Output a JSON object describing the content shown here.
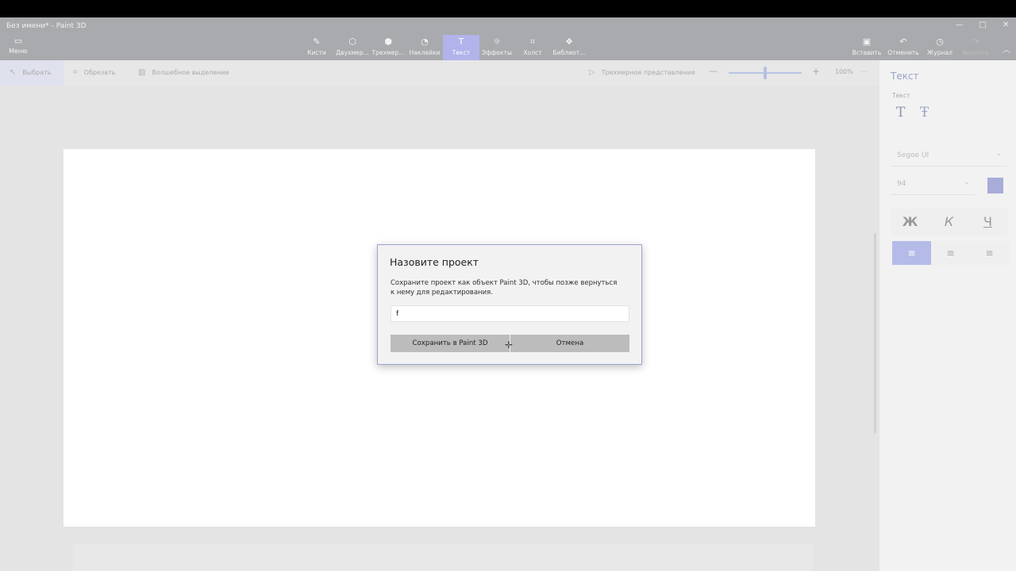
{
  "window": {
    "title": "Без имени* - Paint 3D",
    "minimize": "—",
    "maximize": "□",
    "close": "✕"
  },
  "menu": {
    "label": "Меню",
    "icon": "folder-icon"
  },
  "ribbon": {
    "tools": [
      {
        "label": "Кисти",
        "icon": "brush-icon"
      },
      {
        "label": "Двухмер...",
        "icon": "shapes-2d-icon"
      },
      {
        "label": "Трехмер...",
        "icon": "shapes-3d-icon"
      },
      {
        "label": "Наклейки",
        "icon": "stickers-icon"
      },
      {
        "label": "Текст",
        "icon": "text-icon",
        "active": true
      },
      {
        "label": "Эффекты",
        "icon": "effects-icon"
      },
      {
        "label": "Холст",
        "icon": "canvas-icon"
      },
      {
        "label": "Библиот...",
        "icon": "library-icon"
      }
    ],
    "right": [
      {
        "label": "Вставить",
        "icon": "paste-icon"
      },
      {
        "label": "Отменить",
        "icon": "undo-icon"
      },
      {
        "label": "Журнал",
        "icon": "history-icon"
      },
      {
        "label": "Вернуть",
        "icon": "redo-icon"
      }
    ]
  },
  "subtoolbar": {
    "select": "Выбрать",
    "crop": "Обрезать",
    "magic_select": "Волшебное выделение",
    "view_3d": "Трехмерное представление",
    "zoom": "100%",
    "zoom_level": 0.5,
    "more": "···"
  },
  "panel": {
    "title": "Текст",
    "subtitle": "Текст",
    "font": "Segoe UI",
    "size": "94",
    "color": "#a8acd8",
    "bold": "Ж",
    "italic": "К",
    "underline": "Ч"
  },
  "dialog": {
    "title": "Назовите проект",
    "description": "Сохраните проект как объект Paint 3D, чтобы позже вернуться к нему для редактирования.",
    "input_value": "f",
    "save_button": "Сохранить в Paint 3D",
    "cancel_button": "Отмена"
  }
}
